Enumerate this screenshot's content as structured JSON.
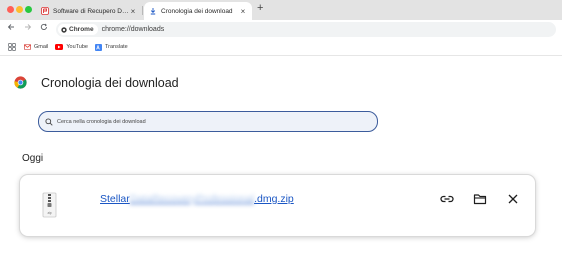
{
  "tabs": [
    {
      "title": "Software di Recupero Dati, S",
      "close": "×"
    },
    {
      "title": "Cronologia dei download",
      "close": "×"
    }
  ],
  "new_tab": "+",
  "omnibox": {
    "chip_label": "Chrome",
    "url": "chrome://downloads"
  },
  "bookmarks": [
    {
      "label": "Gmail"
    },
    {
      "label": "YouTube"
    },
    {
      "label": "Translate"
    }
  ],
  "page": {
    "title": "Cronologia dei download",
    "search_placeholder": "Cerca nella cronologia dei download",
    "section": "Oggi"
  },
  "download": {
    "name_prefix": "Stellar",
    "name_redacted": "DataRecoveryProfessional",
    "name_suffix": ".dmg.zip",
    "icon_caption": "zip"
  },
  "colors": {
    "link": "#1a56c4",
    "search_border": "#3c5c9c",
    "accent_red": "#ff5f57"
  }
}
